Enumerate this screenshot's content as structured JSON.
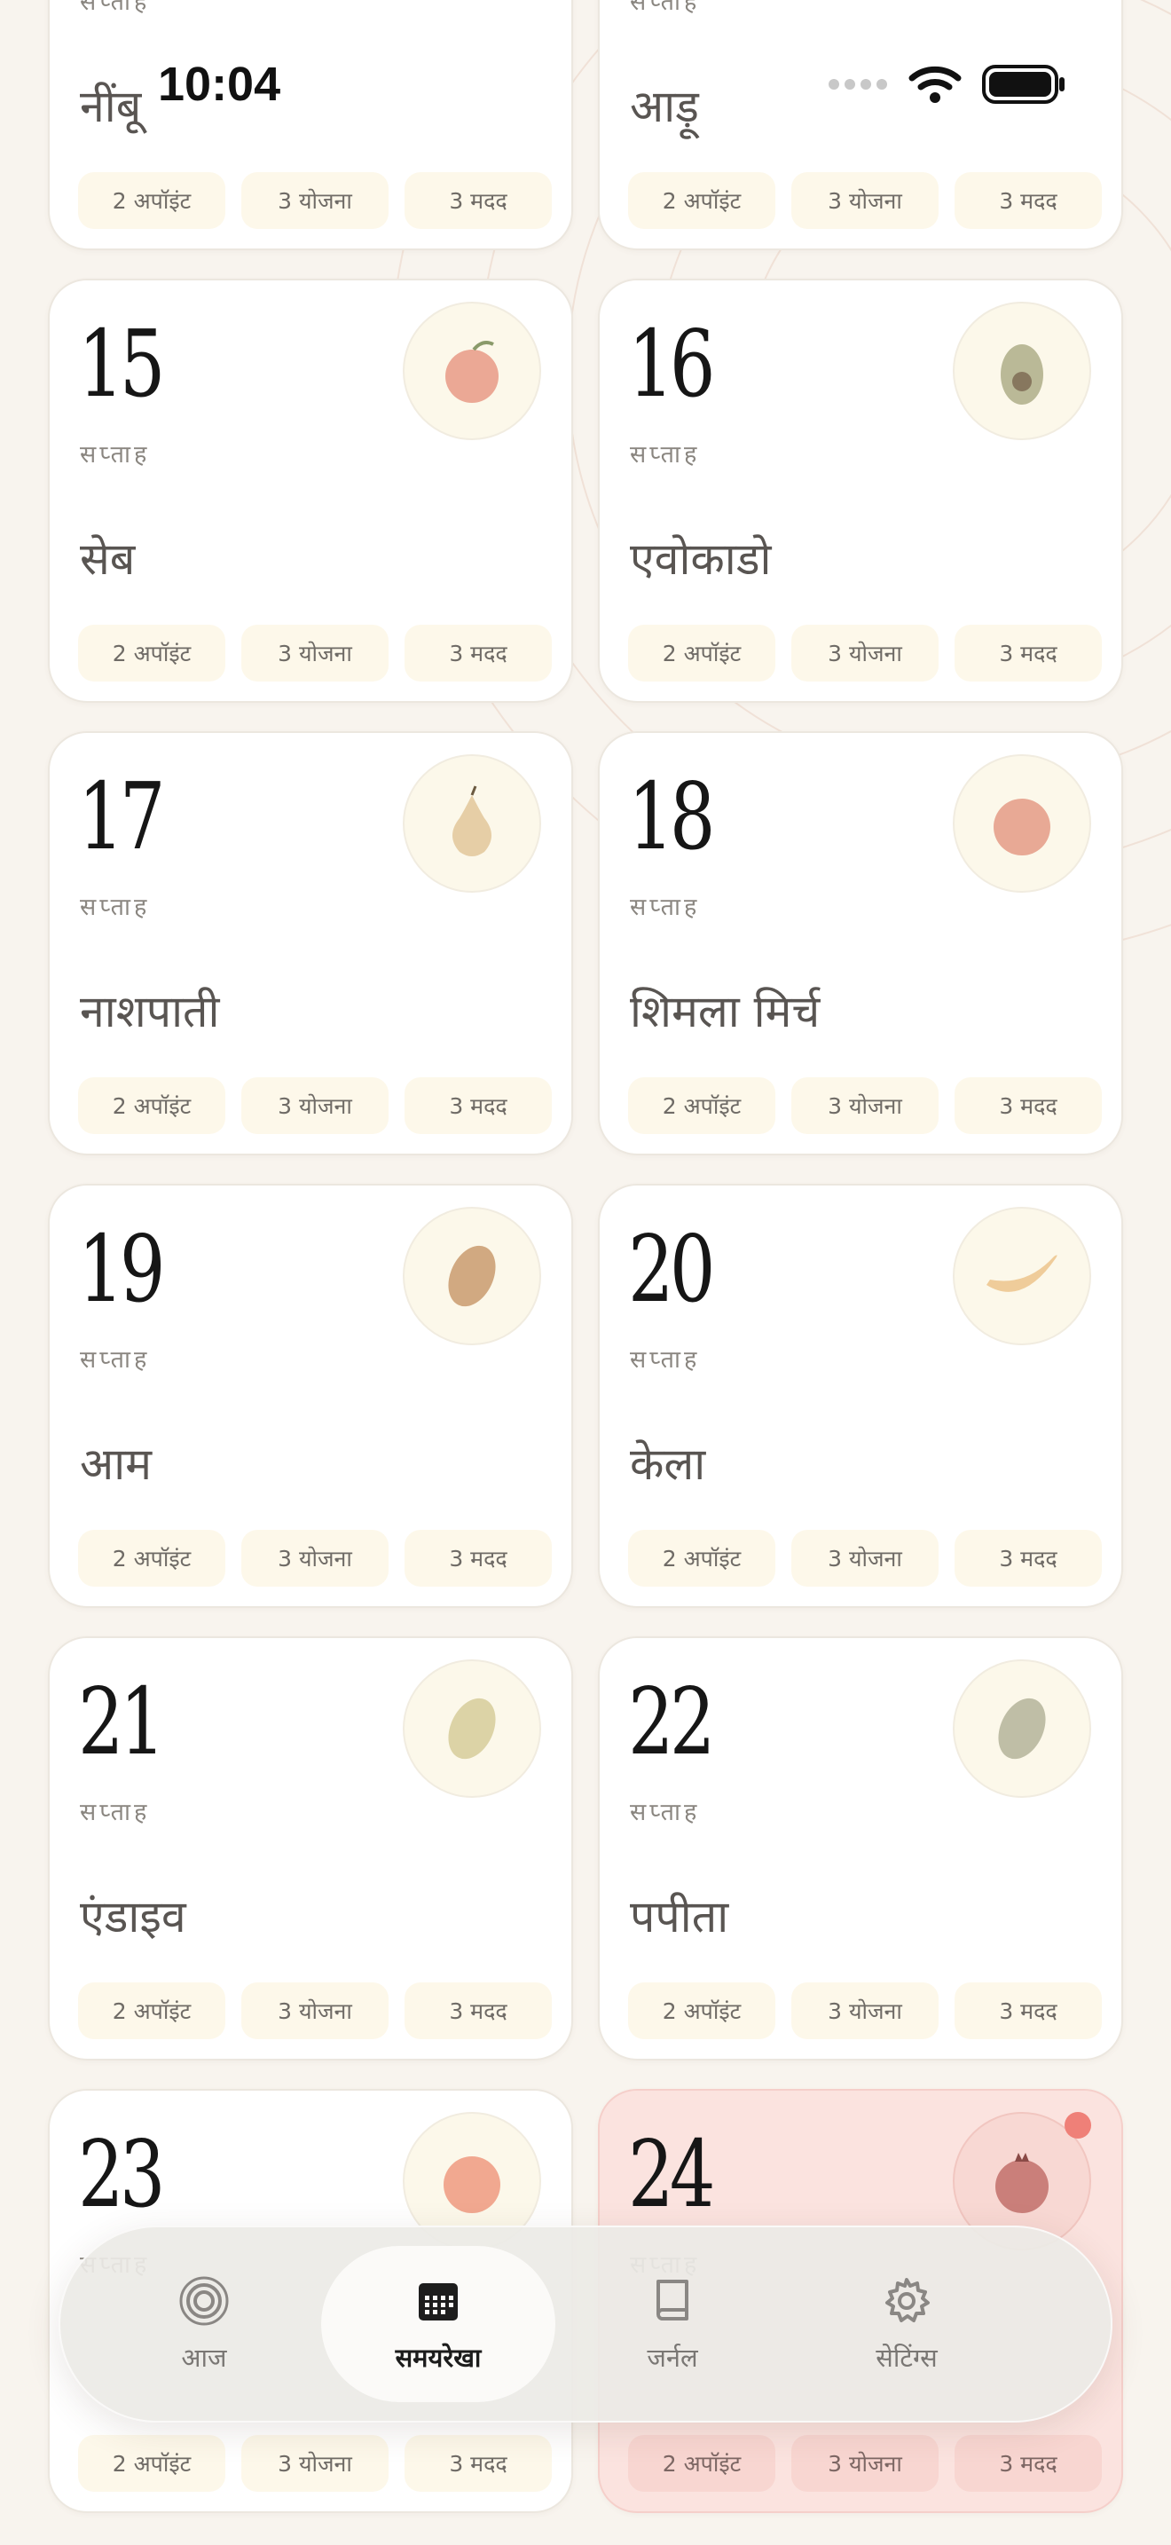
{
  "status_bar": {
    "time": "10:04"
  },
  "week_label": "सप्ताह",
  "chips": {
    "appointments": "2 अपॉइंट",
    "plans": "3 योजना",
    "help": "3 मदद"
  },
  "cards": [
    {
      "week": "",
      "label": "सप्ताह",
      "fruit": "नींबू",
      "fruit_icon": "lemon-icon",
      "color": "#e8d27a"
    },
    {
      "week": "",
      "label": "सप्ताह",
      "fruit": "आड़ू",
      "fruit_icon": "peach-icon",
      "color": "#f0b08a"
    },
    {
      "week": "15",
      "label": "सप्ताह",
      "fruit": "सेब",
      "fruit_icon": "apple-icon",
      "color": "#e79a86"
    },
    {
      "week": "16",
      "label": "सप्ताह",
      "fruit": "एवोकाडो",
      "fruit_icon": "avocado-icon",
      "color": "#a9a982"
    },
    {
      "week": "17",
      "label": "सप्ताह",
      "fruit": "नाशपाती",
      "fruit_icon": "pear-icon",
      "color": "#e2c79a"
    },
    {
      "week": "18",
      "label": "सप्ताह",
      "fruit": "शिमला मिर्च",
      "fruit_icon": "bell-pepper-icon",
      "color": "#e49b86"
    },
    {
      "week": "19",
      "label": "सप्ताह",
      "fruit": "आम",
      "fruit_icon": "mango-icon",
      "color": "#c99b6e"
    },
    {
      "week": "20",
      "label": "सप्ताह",
      "fruit": "केला",
      "fruit_icon": "banana-icon",
      "color": "#ecc48c"
    },
    {
      "week": "21",
      "label": "सप्ताह",
      "fruit": "एंडाइव",
      "fruit_icon": "endive-icon",
      "color": "#d6cc9a"
    },
    {
      "week": "22",
      "label": "सप्ताह",
      "fruit": "पपीता",
      "fruit_icon": "papaya-icon",
      "color": "#b4b49a"
    },
    {
      "week": "23",
      "label": "सप्ताह",
      "fruit": "",
      "fruit_icon": "grapefruit-icon",
      "color": "#ee9a80"
    },
    {
      "week": "24",
      "label": "सप्ताह",
      "fruit": "",
      "fruit_icon": "pomegranate-icon",
      "color": "#c2706a",
      "current": true
    }
  ],
  "nav": {
    "today": "आज",
    "timeline": "समयरेखा",
    "journal": "जर्नल",
    "settings": "सेटिंग्स"
  },
  "colors": {
    "accent_current": "#fbe3df",
    "dot": "#ef8078",
    "chip_bg": "#fdf8ea",
    "page_bg": "#f8f4ee"
  }
}
